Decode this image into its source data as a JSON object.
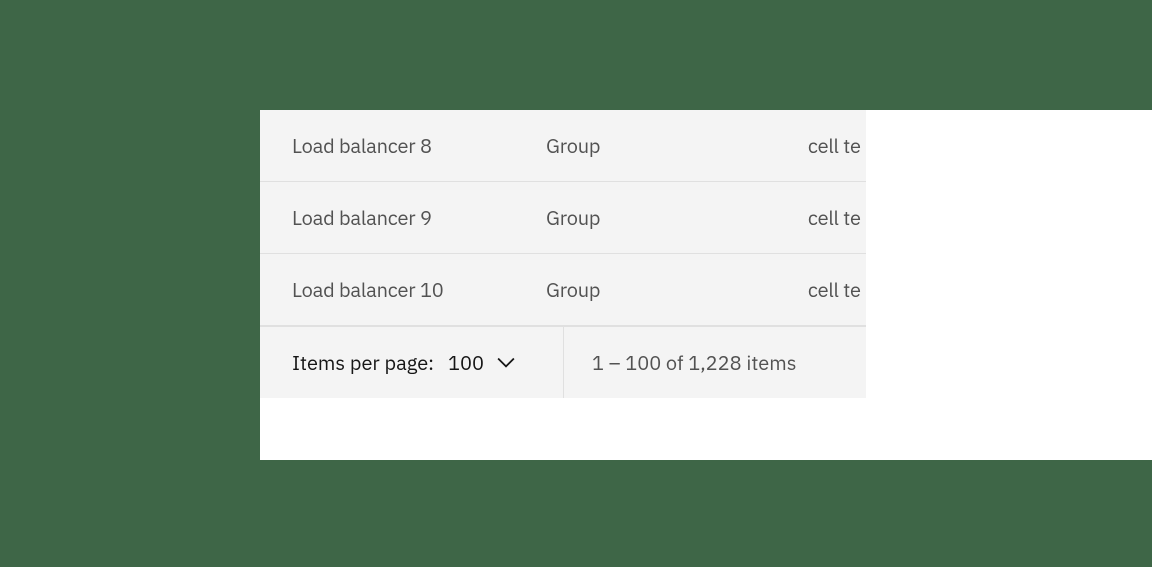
{
  "rows": [
    {
      "name": "Load balancer 8",
      "group": "Group",
      "extra": "cell te"
    },
    {
      "name": "Load balancer 9",
      "group": "Group",
      "extra": "cell te"
    },
    {
      "name": "Load balancer 10",
      "group": "Group",
      "extra": "cell te"
    }
  ],
  "pagination": {
    "items_per_page_label": "Items per page:",
    "items_per_page_value": "100",
    "range_text": "1 – 100 of 1,228 items"
  }
}
